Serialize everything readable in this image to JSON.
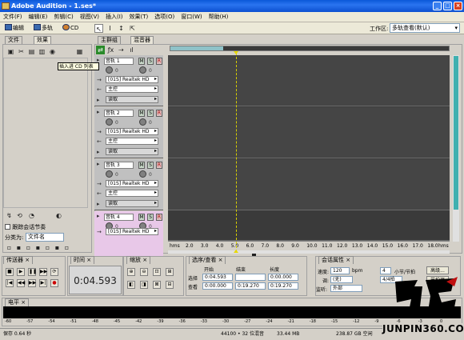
{
  "app": {
    "title": "Adobe Audition - 1.ses*"
  },
  "menu": [
    "文件(F)",
    "编辑(E)",
    "剪辑(C)",
    "视图(V)",
    "插入(I)",
    "效果(T)",
    "选项(O)",
    "窗口(W)",
    "帮助(H)"
  ],
  "toolbar": {
    "edit_label": "编辑",
    "multitrack_label": "多轨",
    "cd_label": "CD",
    "workspace_label": "工作区:",
    "workspace_value": "多轨查看(默认)"
  },
  "left_panel": {
    "tabs": [
      "文件",
      "效果"
    ],
    "tooltip": "插入进 CD 列表",
    "follow_checkbox": "跟踪会话节奏",
    "group_label": "分类为:",
    "group_value": "文件名"
  },
  "main": {
    "tabs": [
      "主群组",
      "混音器"
    ]
  },
  "tracks": [
    {
      "name": "音轨 1",
      "input": "[01S] Realtek HD",
      "output": "主控",
      "fx": "读取"
    },
    {
      "name": "音轨 2",
      "input": "[01S] Realtek HD",
      "output": "主控",
      "fx": "读取"
    },
    {
      "name": "音轨 3",
      "input": "[01S] Realtek HD",
      "output": "主控",
      "fx": "读取"
    },
    {
      "name": "音轨 4",
      "input": "[01S] Realtek HD",
      "output": "主控",
      "fx": "读取"
    }
  ],
  "track_buttons": {
    "mute": "M",
    "solo": "S",
    "record": "R",
    "knob_value": "0"
  },
  "ruler": {
    "unit": "hms",
    "ticks": [
      "2.0",
      "3.0",
      "4.0",
      "5.0",
      "6.0",
      "7.0",
      "8.0",
      "9.0",
      "10.0",
      "11.0",
      "12.0",
      "13.0",
      "14.0",
      "15.0",
      "16.0",
      "17.0",
      "18.0"
    ],
    "end_unit": "hms"
  },
  "transport": {
    "tab": "传送器"
  },
  "time": {
    "tab": "时间",
    "value": "0:04.593"
  },
  "zoom": {
    "tab": "缩放"
  },
  "selection": {
    "tab": "选序/查看",
    "start_header": "开始",
    "end_header": "结束",
    "length_header": "长度",
    "sel_label": "选择",
    "view_label": "查看",
    "sel_start": "0:04.593",
    "sel_end": "",
    "sel_length": "0:00.000",
    "view_start": "0:00.000",
    "view_end": "0:19.270",
    "view_length": "0:19.270"
  },
  "session": {
    "tab": "会话属性",
    "tempo_label": "速度:",
    "tempo_value": "120",
    "bpm_label": "bpm",
    "beats_value": "4",
    "beats_label": "小节/节拍",
    "advanced_button": "高级...",
    "key_label": "调:",
    "key_value": "(无)",
    "time_sig_value": "4/4拍",
    "metronome_button": "节拍器",
    "monitor_label": "监听:",
    "monitor_value": "外部"
  },
  "levels": {
    "tab": "电平",
    "scale": [
      "-60",
      "-57",
      "-54",
      "-51",
      "-48",
      "-45",
      "-42",
      "-39",
      "-36",
      "-33",
      "-30",
      "-27",
      "-24",
      "-21",
      "-18",
      "-15",
      "-12",
      "-9",
      "-6",
      "-3",
      "0"
    ]
  },
  "status": {
    "save": "保存 0.64 秒",
    "format": "44100 • 32 位混音",
    "memory": "33.44 MB",
    "disk": "238.87 GB 空闲"
  },
  "watermark": {
    "site": "JUNPIN360.COM"
  }
}
